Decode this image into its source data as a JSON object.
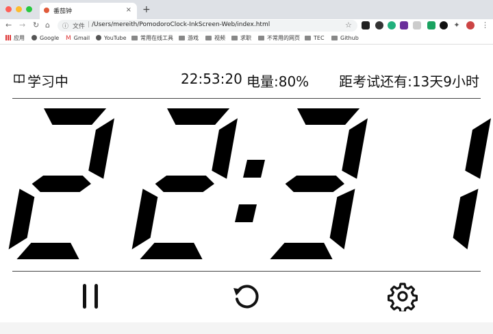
{
  "browser": {
    "tab_title": "番茄钟",
    "tab_close": "×",
    "new_tab": "+",
    "omnibox_scheme": "文件",
    "omnibox_url": "/Users/mereith/PomodoroClock-InkScreen-Web/index.html",
    "bookmarks": [
      {
        "label": "应用",
        "icon": "apps-grid-icon"
      },
      {
        "label": "Google",
        "icon": "globe-icon"
      },
      {
        "label": "Gmail",
        "icon": "gmail-icon"
      },
      {
        "label": "YouTube",
        "icon": "globe-icon"
      },
      {
        "label": "常用在线工具",
        "icon": "folder-icon"
      },
      {
        "label": "游戏",
        "icon": "folder-icon"
      },
      {
        "label": "视频",
        "icon": "folder-icon"
      },
      {
        "label": "求职",
        "icon": "folder-icon"
      },
      {
        "label": "不常用的网页",
        "icon": "folder-icon"
      },
      {
        "label": "TEC",
        "icon": "folder-icon"
      },
      {
        "label": "Github",
        "icon": "folder-icon"
      }
    ]
  },
  "status": {
    "mode": "学习中",
    "clock": "22:53:20",
    "battery": "电量:80%",
    "exam_countdown": "距考试还有:13天9小时"
  },
  "timer": {
    "display": "22:31"
  },
  "controls": {
    "pause_icon": "pause-icon",
    "reset_icon": "reset-icon",
    "settings_icon": "gear-icon"
  }
}
